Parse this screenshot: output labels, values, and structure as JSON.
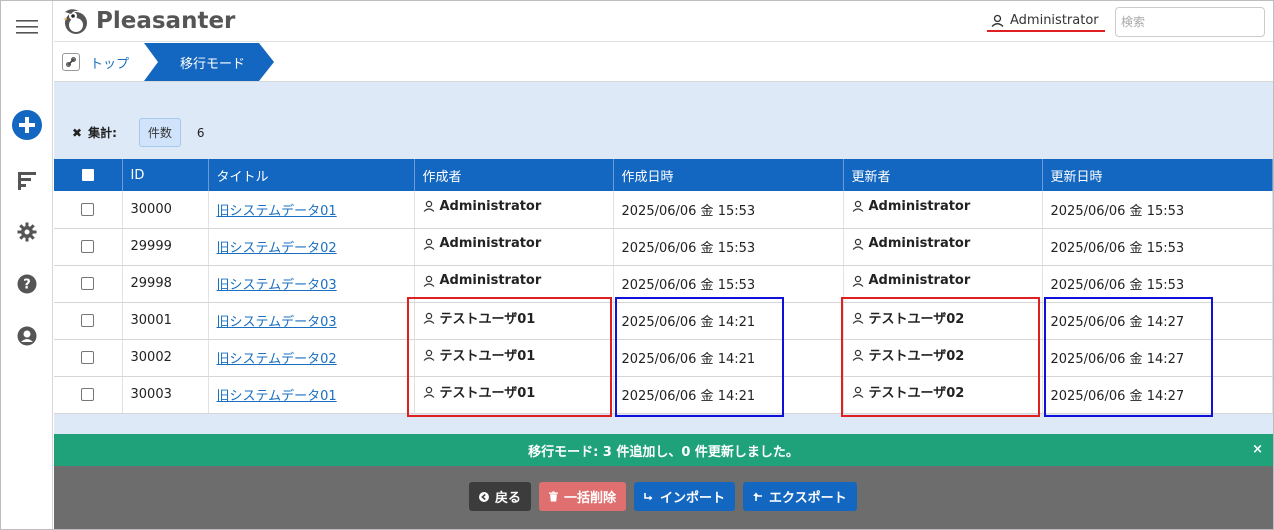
{
  "app": {
    "name": "Pleasanter"
  },
  "header": {
    "user_name": "Administrator",
    "search_placeholder": "検索"
  },
  "breadcrumb": {
    "top": "トップ",
    "current": "移行モード"
  },
  "aggregate": {
    "label": "集計:",
    "badge": "件数",
    "count": "6"
  },
  "grid": {
    "columns": [
      "ID",
      "タイトル",
      "作成者",
      "作成日時",
      "更新者",
      "更新日時"
    ],
    "rows": [
      {
        "id": "30000",
        "title": "旧システムデータ01",
        "creator": "Administrator",
        "created": "2025/06/06 金 15:53",
        "updater": "Administrator",
        "updated": "2025/06/06 金 15:53"
      },
      {
        "id": "29999",
        "title": "旧システムデータ02",
        "creator": "Administrator",
        "created": "2025/06/06 金 15:53",
        "updater": "Administrator",
        "updated": "2025/06/06 金 15:53"
      },
      {
        "id": "29998",
        "title": "旧システムデータ03",
        "creator": "Administrator",
        "created": "2025/06/06 金 15:53",
        "updater": "Administrator",
        "updated": "2025/06/06 金 15:53"
      },
      {
        "id": "30001",
        "title": "旧システムデータ03",
        "creator": "テストユーザ01",
        "created": "2025/06/06 金 14:21",
        "updater": "テストユーザ02",
        "updated": "2025/06/06 金 14:27"
      },
      {
        "id": "30002",
        "title": "旧システムデータ02",
        "creator": "テストユーザ01",
        "created": "2025/06/06 金 14:21",
        "updater": "テストユーザ02",
        "updated": "2025/06/06 金 14:27"
      },
      {
        "id": "30003",
        "title": "旧システムデータ01",
        "creator": "テストユーザ01",
        "created": "2025/06/06 金 14:21",
        "updater": "テストユーザ02",
        "updated": "2025/06/06 金 14:27"
      }
    ]
  },
  "message": {
    "text": "移行モード: 3 件追加し、0 件更新しました。",
    "close": "×"
  },
  "footer": {
    "back": "戻る",
    "bulk_delete": "一括削除",
    "import": "インポート",
    "export": "エクスポート"
  },
  "colors": {
    "primary": "#1467c0",
    "success": "#1fa27a",
    "danger": "#e07070",
    "highlight_red": "#e02020",
    "highlight_blue": "#1010d8"
  }
}
